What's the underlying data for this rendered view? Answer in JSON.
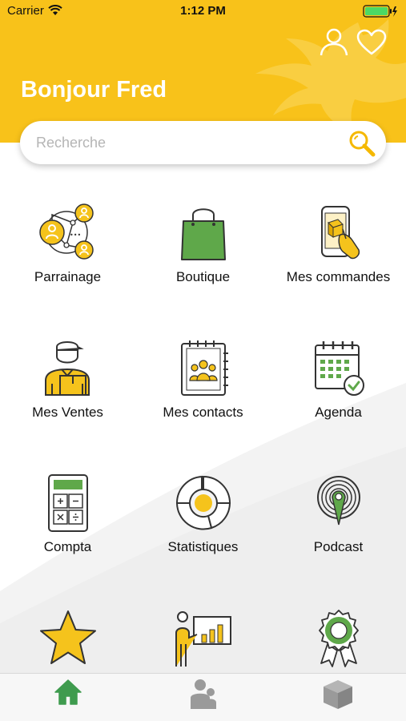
{
  "status_bar": {
    "carrier": "Carrier",
    "time": "1:12 PM",
    "battery_color": "#4cd964"
  },
  "header": {
    "greeting": "Bonjour Fred",
    "background_color": "#f8c21a",
    "icons": [
      "profile-icon",
      "heart-icon"
    ]
  },
  "search": {
    "placeholder": "Recherche",
    "value": "",
    "icon": "search-icon"
  },
  "menu": {
    "items": [
      {
        "label": "Parrainage",
        "icon": "network-icon"
      },
      {
        "label": "Boutique",
        "icon": "shopping-bag-icon"
      },
      {
        "label": "Mes commandes",
        "icon": "order-phone-icon"
      },
      {
        "label": "Mes Ventes",
        "icon": "delivery-person-icon"
      },
      {
        "label": "Mes contacts",
        "icon": "contacts-notebook-icon"
      },
      {
        "label": "Agenda",
        "icon": "calendar-icon"
      },
      {
        "label": "Compta",
        "icon": "calculator-icon"
      },
      {
        "label": "Statistiques",
        "icon": "chart-ring-icon"
      },
      {
        "label": "Podcast",
        "icon": "podcast-icon"
      },
      {
        "label": "",
        "icon": "star-icon"
      },
      {
        "label": "",
        "icon": "presentation-icon"
      },
      {
        "label": "",
        "icon": "award-badge-icon"
      }
    ]
  },
  "tabbar": {
    "tabs": [
      {
        "icon": "home-icon",
        "active": true
      },
      {
        "icon": "people-icon",
        "active": false
      },
      {
        "icon": "box-icon",
        "active": false
      }
    ],
    "active_color": "#3f9b4e",
    "inactive_color": "#9a9a9a"
  },
  "colors": {
    "accent_yellow": "#f8c21a",
    "accent_green": "#5fa84a",
    "outline": "#333333"
  }
}
